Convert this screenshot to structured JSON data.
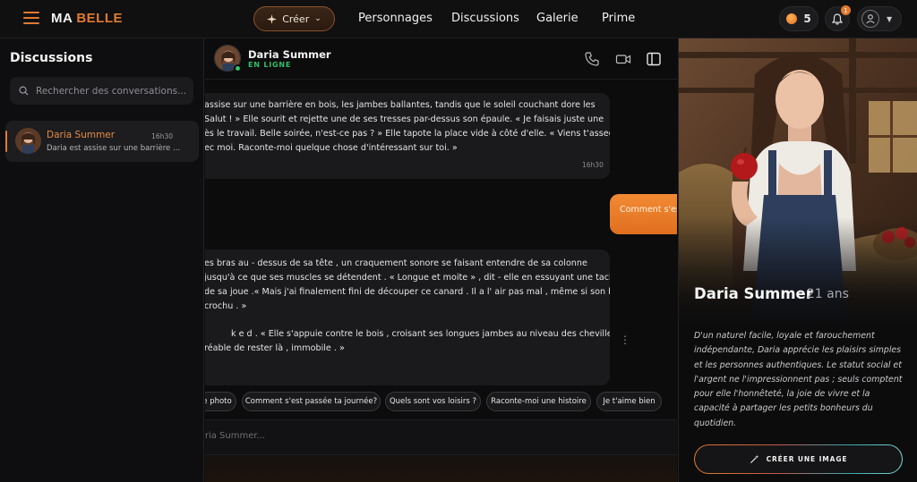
{
  "header": {
    "logo_part1": "MA",
    "logo_part2": "BELLE",
    "create_label": "Créer",
    "nav": [
      "Personnages",
      "Discussions",
      "Galerie",
      "Prime"
    ],
    "coins": "5",
    "notification_count": "1",
    "accent_color": "#e07a2f"
  },
  "sidebar": {
    "title": "Discussions",
    "search_placeholder": "Rechercher des conversations...",
    "conversations": [
      {
        "name": "Daria Summer",
        "time": "16h30",
        "preview": "Daria est assise sur une barrière ..."
      }
    ]
  },
  "chat": {
    "name": "Daria Summer",
    "status": "EN LIGNE",
    "messages": [
      {
        "lines": [
          "assise sur une barrière en bois, les jambes ballantes, tandis que le soleil couchant dore les",
          "Salut ! » Elle sourit et rejette une de ses tresses par-dessus son épaule. « Je faisais juste une",
          "ès le travail. Belle soirée, n'est-ce pas ? » Elle tapote la place vide à côté d'elle. « Viens t'asseoir",
          "ec moi. Raconte-moi quelque chose d'intéressant sur toi. »"
        ],
        "time": "16h30"
      },
      {
        "lines": [
          "es bras au - dessus de sa tête , un craquement sonore se faisant entendre de sa colonne",
          " jusqu'à ce que ses muscles se détendent . « Longue et moite » , dit - elle en essuyant une tache",
          "de sa joue .« Mais j'ai finalement fini de découper ce canard . Il a l' air pas mal , même si son bec",
          " crochu . »",
          "",
          "k e d . « Elle s'appuie contre le bois , croisant ses longues jambes au niveau des chevilles . »",
          "réable de rester là , immobile . »"
        ]
      }
    ],
    "user_message": "Comment s'es",
    "suggestions": [
      "e photo",
      "Comment s'est passée ta journée?",
      "Quels sont vos loisirs ?",
      "Raconte-moi une histoire",
      "Je t'aime bien"
    ],
    "input_placeholder": "Daria Summer..."
  },
  "profile": {
    "name": "Daria Summer",
    "age": "· 21 ans",
    "description_lines": [
      "D'un naturel facile, loyale et farouchement",
      "indépendante, Daria apprécie les plaisirs simples",
      "et les personnes authentiques. Le statut social et",
      "l'argent ne l'impressionnent pas ; seuls comptent",
      "pour elle l'honnêteté, la joie de vivre et la",
      "capacité à partager les petits bonheurs du",
      "quotidien."
    ],
    "cta_label": "CRÉER UNE IMAGE"
  }
}
